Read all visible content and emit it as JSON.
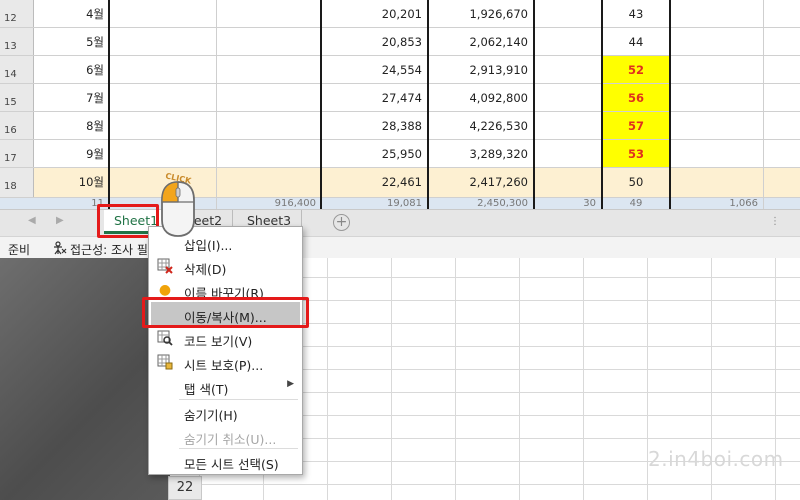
{
  "rows": [
    {
      "num": "12",
      "month": "4월",
      "d": "20,201",
      "e": "1,926,670",
      "g": "43"
    },
    {
      "num": "13",
      "month": "5월",
      "d": "20,853",
      "e": "2,062,140",
      "g": "44"
    },
    {
      "num": "14",
      "month": "6월",
      "d": "24,554",
      "e": "2,913,910",
      "g": "52"
    },
    {
      "num": "15",
      "month": "7월",
      "d": "27,474",
      "e": "4,092,800",
      "g": "56"
    },
    {
      "num": "16",
      "month": "8월",
      "d": "28,388",
      "e": "4,226,530",
      "g": "57"
    },
    {
      "num": "17",
      "month": "9월",
      "d": "25,950",
      "e": "3,289,320",
      "g": "53"
    },
    {
      "num": "18",
      "month": "10월",
      "d": "22,461",
      "e": "2,417,260",
      "g": "50"
    }
  ],
  "partial_row": {
    "a": "11",
    "c": "916,400",
    "d": "19,081",
    "e": "2,450,300",
    "f": "30",
    "g": "49",
    "i": "1,066"
  },
  "tabs": [
    "Sheet1",
    "Sheet2",
    "Sheet3"
  ],
  "status": {
    "ready": "준비",
    "accessibility": "접근성: 조사 필"
  },
  "menu": [
    {
      "label": "삽입(I)...",
      "icon": "",
      "disabled": false
    },
    {
      "label": "삭제(D)",
      "icon": "delete-sheet-icon",
      "disabled": false
    },
    {
      "label": "이름 바꾸기(R)",
      "icon": "rename-dot-icon",
      "disabled": false
    },
    {
      "label": "이동/복사(M)...",
      "icon": "",
      "disabled": false,
      "selected": true
    },
    {
      "label": "코드 보기(V)",
      "icon": "view-code-icon",
      "disabled": false
    },
    {
      "label": "시트 보호(P)...",
      "icon": "protect-sheet-icon",
      "disabled": false
    },
    {
      "label": "탭 색(T)",
      "icon": "",
      "disabled": false,
      "submenu": true
    },
    {
      "label": "숨기기(H)",
      "icon": "",
      "disabled": false
    },
    {
      "label": "숨기기 취소(U)...",
      "icon": "",
      "disabled": true
    },
    {
      "label": "모든 시트 선택(S)",
      "icon": "",
      "disabled": false
    }
  ],
  "mouse_label": "CLICK",
  "back_row_num": "22",
  "watermark": "2.in4boi.com",
  "colors": {
    "highlight_yellow": "#ffff00",
    "value_red": "#e0301e",
    "red_box": "#e41a1a",
    "excel_green": "#217346"
  }
}
